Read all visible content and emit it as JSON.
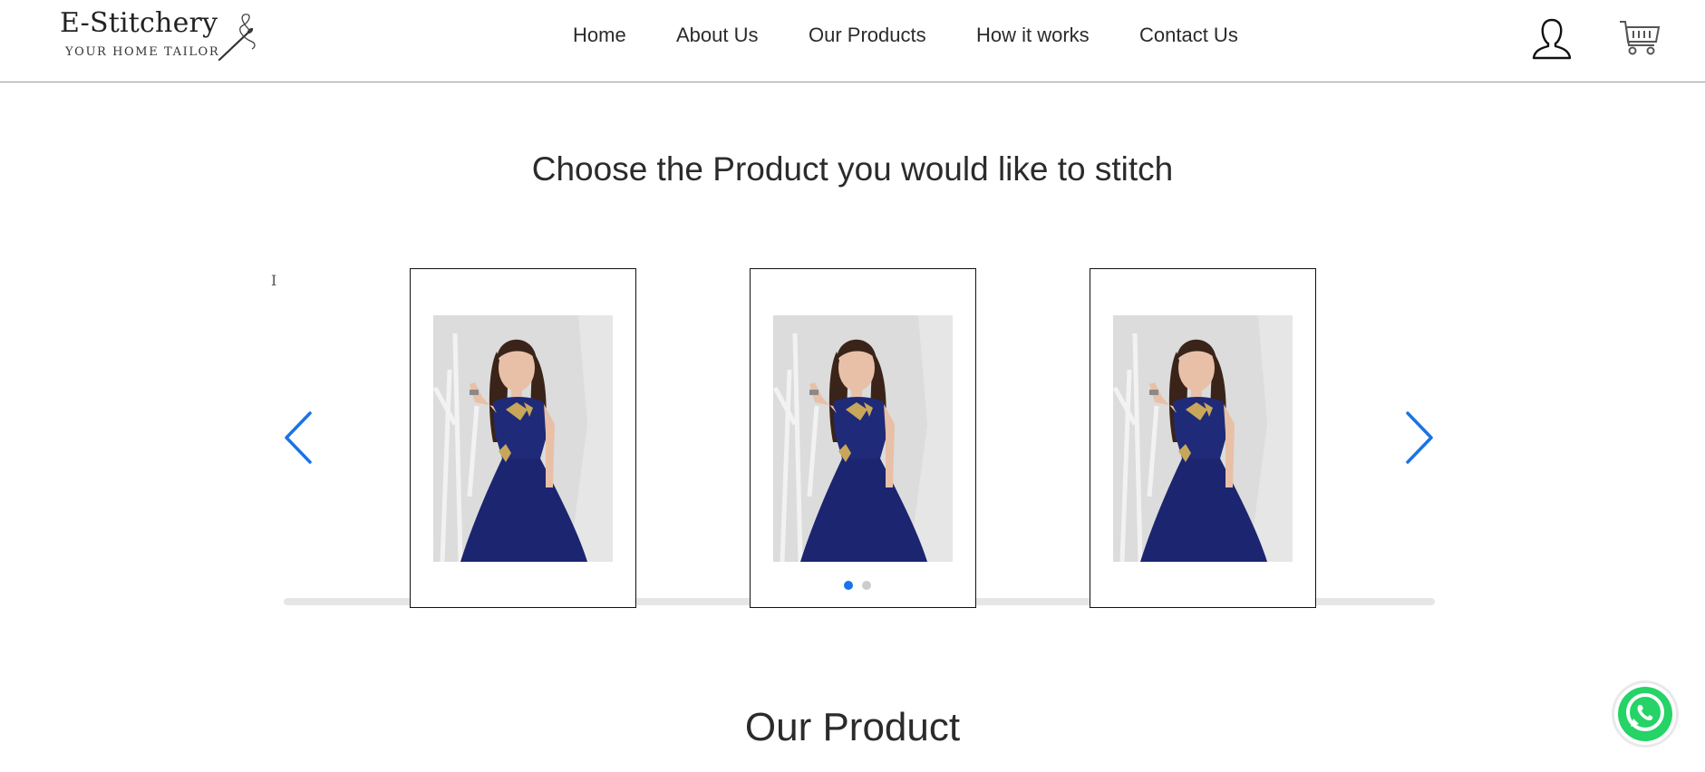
{
  "header": {
    "logo": {
      "title": "E-Stitchery",
      "tagline": "YOUR HOME TAILOR"
    },
    "nav": [
      {
        "label": "Home"
      },
      {
        "label": "About Us"
      },
      {
        "label": "Our Products"
      },
      {
        "label": "How it works"
      },
      {
        "label": "Contact Us"
      }
    ],
    "icons": {
      "user": "user-account-icon",
      "cart": "shopping-cart-icon"
    }
  },
  "carousel": {
    "title": "Choose the Product you would like to stitch",
    "cursor_mark": "I",
    "items": [
      {
        "image": "woman-in-navy-embroidered-gown"
      },
      {
        "image": "woman-in-navy-embroidered-gown"
      },
      {
        "image": "woman-in-navy-embroidered-gown"
      }
    ],
    "page_count": 2,
    "active_page": 1,
    "colors": {
      "accent": "#1a73e8",
      "dot_inactive": "#cccccc",
      "track": "#e6e6e6"
    }
  },
  "products": {
    "title": "Our Product"
  },
  "floating": {
    "whatsapp_icon": "whatsapp-icon",
    "color": "#25d366"
  }
}
